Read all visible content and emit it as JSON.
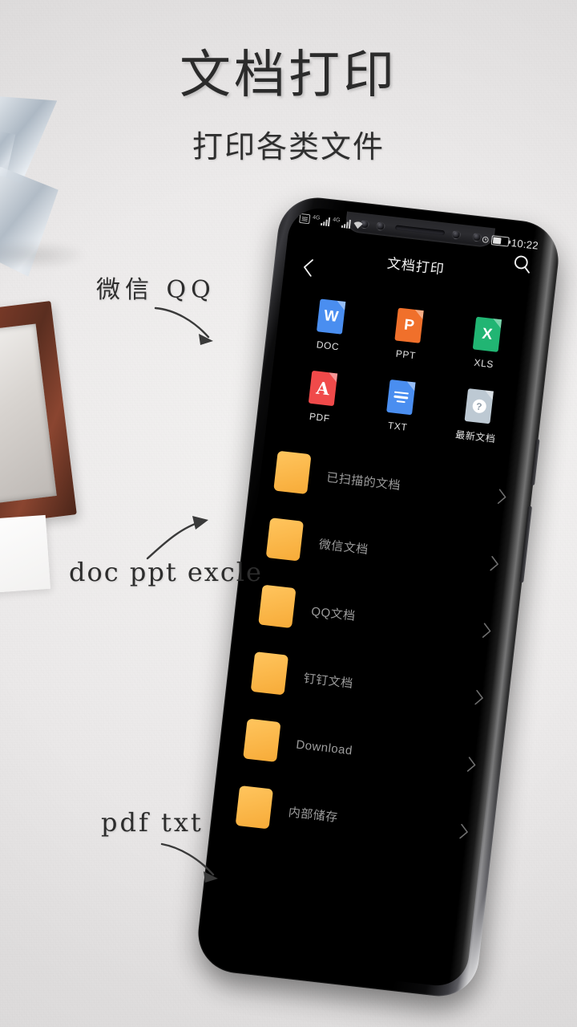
{
  "poster": {
    "title": "文档打印",
    "subtitle": "打印各类文件",
    "annotations": [
      {
        "text": "微信  QQ",
        "name": "annotation-wechat-qq"
      },
      {
        "text": "doc  ppt  excle",
        "name": "annotation-doc-ppt-excle"
      },
      {
        "text": "pdf  txt",
        "name": "annotation-pdf-txt"
      }
    ]
  },
  "phone": {
    "statusbar": {
      "sim_icon": "sim-card-icon",
      "signal_1_label": "4G",
      "signal_1_icon": "signal-bars-icon",
      "signal_2_label": "4G",
      "signal_2_icon": "signal-bars-icon",
      "wifi_icon": "wifi-icon",
      "alarm_icon": "alarm-icon",
      "battery_icon": "battery-icon",
      "time": "10:22"
    },
    "header": {
      "back_icon": "chevron-left-icon",
      "title": "文档打印",
      "search_icon": "search-icon"
    },
    "grid": [
      {
        "label": "DOC",
        "glyph": "W",
        "color": "#4a8ef0",
        "corner": "#7db0f6",
        "icon": "doc-file-icon",
        "kind": "letter"
      },
      {
        "label": "PPT",
        "glyph": "P",
        "color": "#f0702b",
        "corner": "#f79a66",
        "icon": "ppt-file-icon",
        "kind": "letter"
      },
      {
        "label": "XLS",
        "glyph": "X",
        "color": "#21b573",
        "corner": "#64d3a3",
        "icon": "xls-file-icon",
        "kind": "letter"
      },
      {
        "label": "PDF",
        "glyph": "A",
        "color": "#f04a4a",
        "corner": "#f58585",
        "icon": "pdf-file-icon",
        "kind": "pdf"
      },
      {
        "label": "TXT",
        "glyph": "",
        "color": "#4a8ef0",
        "corner": "#7db0f6",
        "icon": "txt-file-icon",
        "kind": "lines"
      },
      {
        "label": "最新文档",
        "glyph": "?",
        "color": "#bdc9d3",
        "corner": "#dde5eb",
        "icon": "recent-file-icon",
        "kind": "question"
      }
    ],
    "list": [
      {
        "label": "已扫描的文档",
        "icon": "folder-icon",
        "chevron": "chevron-right-icon"
      },
      {
        "label": "微信文档",
        "icon": "folder-icon",
        "chevron": "chevron-right-icon"
      },
      {
        "label": "QQ文档",
        "icon": "folder-icon",
        "chevron": "chevron-right-icon"
      },
      {
        "label": "钉钉文档",
        "icon": "folder-icon",
        "chevron": "chevron-right-icon"
      },
      {
        "label": "Download",
        "icon": "folder-icon",
        "chevron": "chevron-right-icon"
      },
      {
        "label": "内部储存",
        "icon": "folder-icon",
        "chevron": "chevron-right-icon"
      }
    ]
  },
  "colors": {
    "background": "#eceaea",
    "screen": "#000000",
    "folder_accent": "#f9b43f",
    "text_primary": "#2b2b2b",
    "list_text": "#9d9d9d"
  }
}
